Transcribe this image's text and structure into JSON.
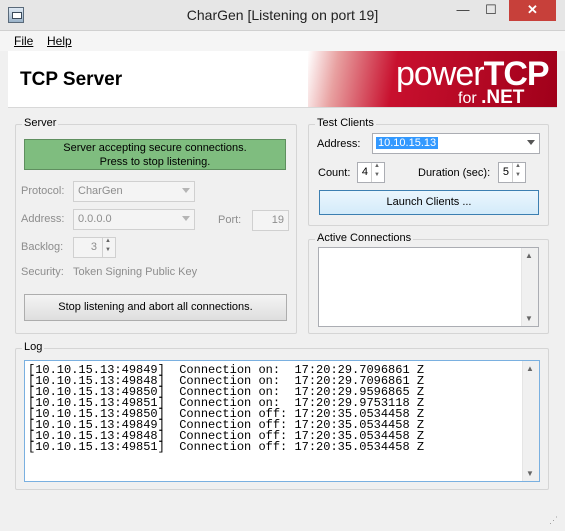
{
  "window": {
    "title": "CharGen [Listening on port 19]",
    "min": "—",
    "max": "☐",
    "close": "✕"
  },
  "menu": {
    "file": "File",
    "help": "Help"
  },
  "banner": {
    "title": "TCP Server",
    "brand_light": "power",
    "brand_bold": "TCP",
    "brand_sub_light": "for ",
    "brand_sub_bold": ".NET"
  },
  "server": {
    "group_label": "Server",
    "status_line1": "Server accepting secure connections.",
    "status_line2": "Press to stop listening.",
    "status_color": "#7fbd7f",
    "protocol_label": "Protocol:",
    "protocol_value": "CharGen",
    "address_label": "Address:",
    "address_value": "0.0.0.0",
    "port_label": "Port:",
    "port_value": "19",
    "backlog_label": "Backlog:",
    "backlog_value": "3",
    "security_label": "Security:",
    "security_value": "Token Signing Public Key",
    "stop_button": "Stop listening and abort all connections."
  },
  "test_clients": {
    "group_label": "Test Clients",
    "address_label": "Address:",
    "address_value": "10.10.15.13",
    "count_label": "Count:",
    "count_value": "4",
    "duration_label": "Duration (sec):",
    "duration_value": "5",
    "launch_button": "Launch Clients ..."
  },
  "active_connections": {
    "group_label": "Active Connections"
  },
  "log": {
    "group_label": "Log",
    "lines": [
      "[10.10.15.13:49849]  Connection on:  17:20:29.7096861 Z",
      "[10.10.15.13:49848]  Connection on:  17:20:29.7096861 Z",
      "[10.10.15.13:49850]  Connection on:  17:20:29.9596865 Z",
      "[10.10.15.13:49851]  Connection on:  17:20:29.9753118 Z",
      "[10.10.15.13:49850]  Connection off: 17:20:35.0534458 Z",
      "[10.10.15.13:49849]  Connection off: 17:20:35.0534458 Z",
      "[10.10.15.13:49848]  Connection off: 17:20:35.0534458 Z",
      "[10.10.15.13:49851]  Connection off: 17:20:35.0534458 Z"
    ]
  }
}
